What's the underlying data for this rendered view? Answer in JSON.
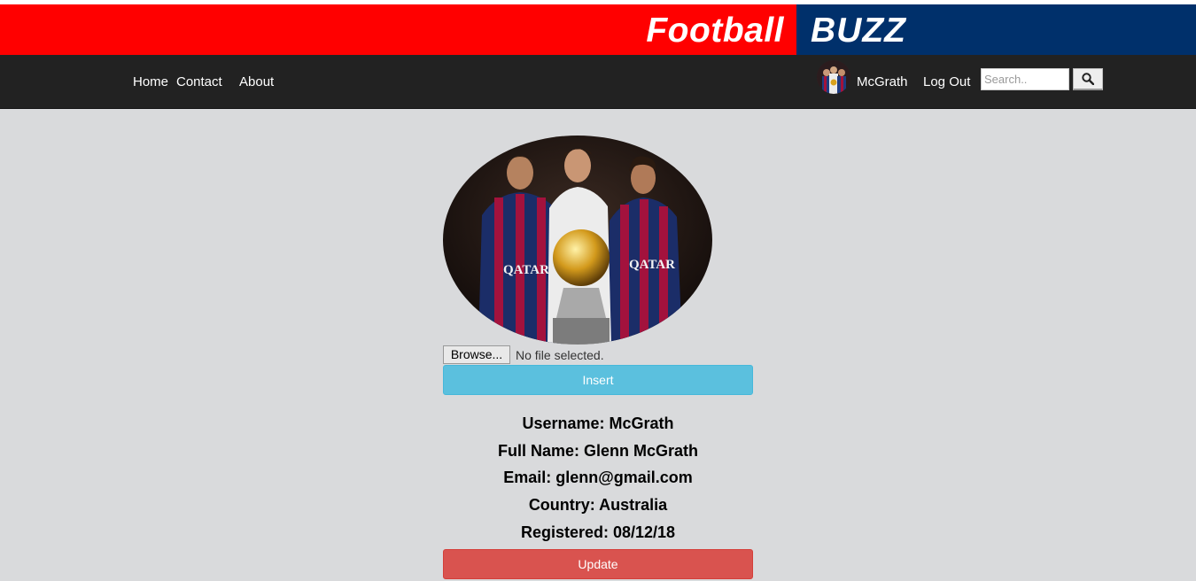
{
  "brand": {
    "left": "Football",
    "right": "BUZZ"
  },
  "nav": {
    "links": [
      "Home",
      "Contact",
      "About"
    ],
    "username": "McGrath",
    "logout": "Log Out",
    "search_placeholder": "Search.."
  },
  "profile": {
    "browse_label": "Browse...",
    "file_status": "No file selected.",
    "insert_label": "Insert",
    "fields": [
      "Username: McGrath",
      "Full Name: Glenn McGrath",
      "Email: glenn@gmail.com",
      "Country: Australia",
      "Registered: 08/12/18"
    ],
    "update_label": "Update"
  },
  "colors": {
    "banner_red": "#ff0000",
    "banner_blue": "#00306b",
    "navbar": "#222222",
    "background": "#d9dadc",
    "insert_button": "#5bc0de",
    "update_button": "#d9534f"
  },
  "icons": {
    "search": "search-icon"
  }
}
